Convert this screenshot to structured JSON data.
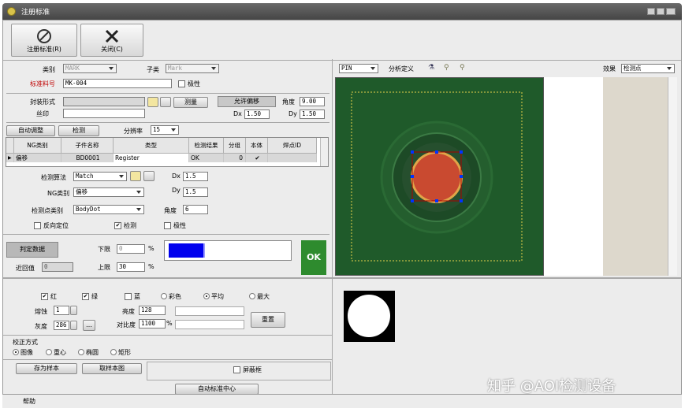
{
  "window": {
    "title": "注册标准"
  },
  "toolbar": {
    "register_label": "注册标准(R)",
    "close_label": "关闭(C)"
  },
  "form": {
    "category_label": "类别",
    "category_value": "MARK",
    "subcategory_label": "子类",
    "subcategory_value": "Mark",
    "part_no_label": "标准料号",
    "part_no_value": "MK-004",
    "polarity_label": "极性",
    "package_label": "封装形式",
    "package_value": "",
    "silk_label": "丝印",
    "silk_value": "",
    "measure_label": "测量",
    "allow_offset_label": "允许偏移",
    "angle_label": "角度",
    "angle_value": "9.00",
    "dx_label": "Dx",
    "dx_value": "1.50",
    "dy_label": "Dy",
    "dy_value": "1.50"
  },
  "controls": {
    "auto_adjust_label": "自动调整",
    "detect_label": "检测",
    "resolution_label": "分辨率",
    "resolution_value": "15"
  },
  "grid": {
    "headers": [
      "NG类别",
      "子件名称",
      "类型",
      "检测结果",
      "分组",
      "本体",
      "焊点ID"
    ],
    "row": {
      "ng": "偏移",
      "name": "BD0001",
      "type": "Register",
      "result": "OK",
      "group": "0",
      "body": "✔",
      "pad": ""
    }
  },
  "detect": {
    "algo_label": "检测算法",
    "algo_value": "Match",
    "dx_label": "Dx",
    "dx_value": "1.5",
    "ng_label": "NG类别",
    "ng_value": "偏移",
    "dy_label": "Dy",
    "dy_value": "1.5",
    "point_label": "检测点类别",
    "point_value": "BodyDot",
    "angle_label": "角度",
    "angle_value": "6",
    "reverse_label": "反向定位",
    "check_label": "检测",
    "polarity_label": "极性"
  },
  "judge": {
    "label": "判定数据",
    "near_label": "近回值",
    "near_value": "0",
    "lower_label": "下限",
    "lower_value": "0",
    "upper_label": "上限",
    "upper_value": "30",
    "pct": "%",
    "result": "OK",
    "ok_color": "#2e8b2e",
    "bar_color": "#0000ee"
  },
  "image_toolbar": {
    "pin_value": "PIN",
    "analysis_label": "分析定义",
    "effect_label": "效果",
    "effect_value": "检测点"
  },
  "color": {
    "red": "红",
    "green": "绿",
    "blue": "蓝",
    "color_mode": "彩色",
    "average": "平均",
    "max": "最大",
    "erode_label": "熔蚀",
    "erode_value": "1",
    "gray_label": "灰度",
    "gray_value": "286",
    "brightness_label": "亮度",
    "brightness_value": "128",
    "contrast_label": "对比度",
    "contrast_value": "1100",
    "contrast_unit": "%",
    "reset_label": "重置"
  },
  "correction": {
    "title": "校正方式",
    "image": "图像",
    "center": "重心",
    "ellipse": "椭圆",
    "rect": "矩形"
  },
  "actions": {
    "save_sample": "存为样本",
    "take_image": "取样本图",
    "screen_label": "屏蔽框",
    "auto_center": "自动标准中心"
  },
  "statusbar": {
    "help": "帮助"
  },
  "watermark": "知乎 @AOI检测设备"
}
